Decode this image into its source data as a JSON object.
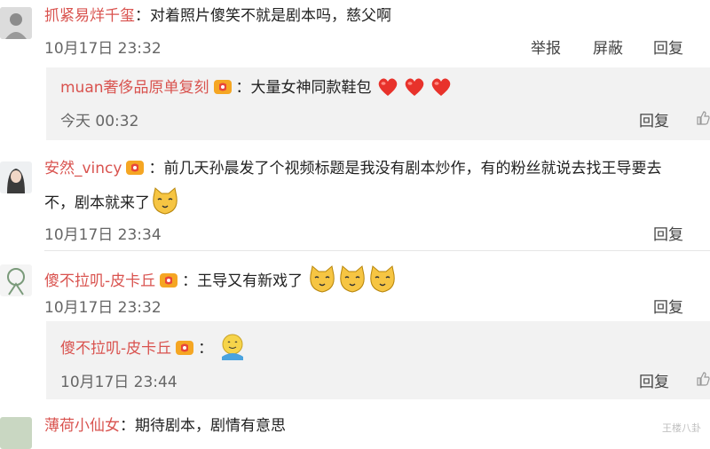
{
  "comments": [
    {
      "user": "抓紧易烊千玺",
      "text": "：对着照片傻笑不就是剧本吗，慈父啊",
      "time": "10月17日 23:32",
      "actions": [
        "举报",
        "屏蔽",
        "回复"
      ]
    },
    {
      "user": "安然_vincy",
      "text": "：前几天孙晨发了个视频标题是我没有剧本炒作，有的粉丝就说去找王导要去",
      "text2": "不，剧本就来了",
      "time": "10月17日 23:34",
      "actions": [
        "回复"
      ]
    },
    {
      "user": "傻不拉叽-皮卡丘",
      "text": "：王导又有新戏了",
      "time": "10月17日 23:32",
      "actions": [
        "回复"
      ]
    },
    {
      "user": "薄荷小仙女",
      "text": "：期待剧本，剧情有意思"
    }
  ],
  "replies": [
    {
      "user": "muan奢侈品原单复刻",
      "text": "：大量女神同款鞋包",
      "time": "今天 00:32",
      "action": "回复"
    },
    {
      "user": "傻不拉叽-皮卡丘",
      "text": "：",
      "time": "10月17日 23:44",
      "action": "回复"
    }
  ],
  "watermark": "王楼八卦",
  "icons": {
    "badge": "member-badge-icon",
    "heart": "heart-emoji-icon",
    "cat": "cat-emoji-icon",
    "smile": "smile-emoji-icon",
    "like": "thumb-up-icon"
  },
  "colors": {
    "nickname": "#d9534f",
    "reply_bg": "#f2f2f2",
    "text": "#222222"
  }
}
